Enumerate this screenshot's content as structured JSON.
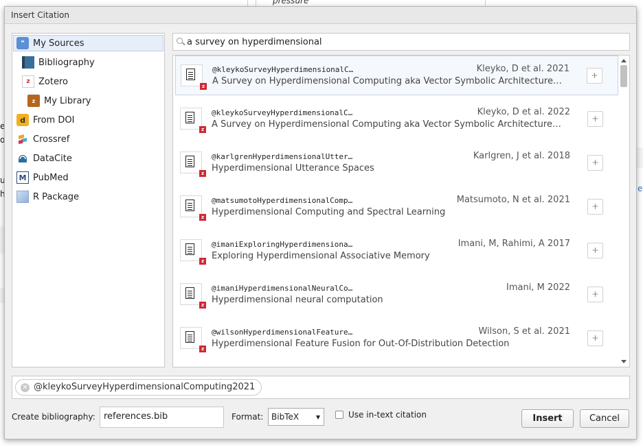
{
  "background": {
    "fragment_top": "pressure",
    "edge_letters": [
      "e",
      "o",
      "ue",
      "h"
    ],
    "right_edge_letter": "e"
  },
  "dialog": {
    "title": "Insert Citation"
  },
  "sources": {
    "items": [
      {
        "label": "My Sources",
        "icon": "my-sources-icon",
        "color": "#5b8fd6"
      },
      {
        "label": "Bibliography",
        "icon": "bibliography-icon",
        "color": "#3b6e9c"
      },
      {
        "label": "Zotero",
        "icon": "zotero-icon",
        "color": "#cc2936"
      },
      {
        "label": "My Library",
        "icon": "library-icon",
        "color": "#b5651d"
      },
      {
        "label": "From DOI",
        "icon": "doi-icon",
        "color": "#f2b01e"
      },
      {
        "label": "Crossref",
        "icon": "crossref-icon",
        "color": "#3eb1c8"
      },
      {
        "label": "DataCite",
        "icon": "datacite-icon",
        "color": "#2d6f9c"
      },
      {
        "label": "PubMed",
        "icon": "pubmed-icon",
        "color": "#2b4d7a"
      },
      {
        "label": "R Package",
        "icon": "r-package-icon",
        "color": "#a9c4e4"
      }
    ]
  },
  "search": {
    "value": "a survey on hyperdimensional"
  },
  "results": [
    {
      "citekey": "@kleykoSurveyHyperdimensionalC…",
      "author": "Kleyko, D et al. 2021",
      "title": "A Survey on Hyperdimensional Computing aka Vector Symbolic Architecture…"
    },
    {
      "citekey": "@kleykoSurveyHyperdimensionalC…",
      "author": "Kleyko, D et al. 2022",
      "title": "A Survey on Hyperdimensional Computing aka Vector Symbolic Architecture…"
    },
    {
      "citekey": "@karlgrenHyperdimensionalUtter…",
      "author": "Karlgren, J et al. 2018",
      "title": "Hyperdimensional Utterance Spaces"
    },
    {
      "citekey": "@matsumotoHyperdimensionalComp…",
      "author": "Matsumoto, N et al. 2021",
      "title": "Hyperdimensional Computing and Spectral Learning"
    },
    {
      "citekey": "@imaniExploringHyperdimensiona…",
      "author": "Imani, M, Rahimi, A 2017",
      "title": "Exploring Hyperdimensional Associative Memory"
    },
    {
      "citekey": "@imaniHyperdimensionalNeuralCo…",
      "author": "Imani, M 2022",
      "title": "Hyperdimensional neural computation"
    },
    {
      "citekey": "@wilsonHyperdimensionalFeature…",
      "author": "Wilson, S et al. 2021",
      "title": "Hyperdimensional Feature Fusion for Out-Of-Distribution Detection"
    }
  ],
  "result_badge": "z",
  "add_label": "+",
  "selected_citation": "@kleykoSurveyHyperdimensionalComputing2021",
  "bottom": {
    "bib_label": "Create bibliography:",
    "bib_value": "references.bib",
    "format_label": "Format:",
    "format_value": "BibTeX",
    "intext_label": "Use in-text citation",
    "insert_label": "Insert",
    "cancel_label": "Cancel"
  }
}
